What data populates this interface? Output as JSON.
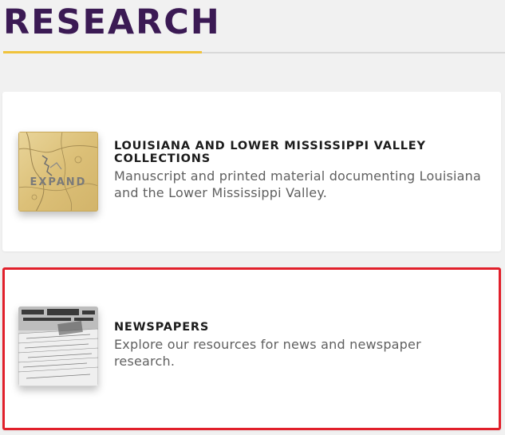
{
  "page": {
    "title": "RESEARCH"
  },
  "colors": {
    "title": "#3b1a54",
    "accent_rule": "#f0c33c",
    "highlight_border": "#e1202b"
  },
  "cards": [
    {
      "heading": "LOUISIANA AND LOWER MISSISSIPPI VALLEY COLLECTIONS",
      "description": "Manuscript and printed material documenting Louisiana and the Lower Mississippi Valley.",
      "thumbnail_icon": "antique-map-thumbnail",
      "thumbnail_overlay": "EXPAND"
    },
    {
      "heading": "NEWSPAPERS",
      "description": "Explore our resources for news and newspaper research.",
      "thumbnail_icon": "newspaper-stack-thumbnail",
      "highlighted": true
    }
  ]
}
